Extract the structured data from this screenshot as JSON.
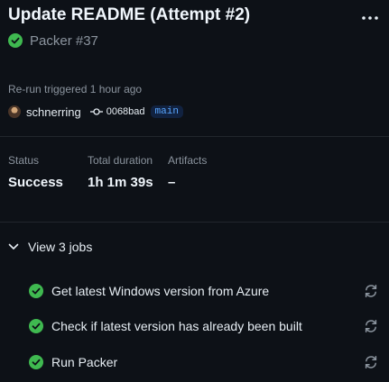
{
  "run": {
    "title": "Update README (Attempt #2)",
    "workflow": "Packer #37",
    "status_color": "#3fb950",
    "trigger_text": "Re-run triggered 1 hour ago",
    "actor": "schnerring",
    "commit_sha": "0068bad",
    "branch": "main"
  },
  "stats": {
    "status_label": "Status",
    "status_value": "Success",
    "duration_label": "Total duration",
    "duration_value": "1h 1m 39s",
    "artifacts_label": "Artifacts",
    "artifacts_value": "–"
  },
  "jobs": {
    "toggle_label": "View 3 jobs",
    "items": [
      {
        "label": "Get latest Windows version from Azure",
        "status": "success",
        "icon": "check-circle-icon",
        "action_icon": "rerun-icon"
      },
      {
        "label": "Check if latest version has already been built",
        "status": "success",
        "icon": "check-circle-icon",
        "action_icon": "rerun-icon"
      },
      {
        "label": "Run Packer",
        "status": "success",
        "icon": "check-circle-icon",
        "action_icon": "rerun-icon"
      }
    ]
  },
  "icons": {
    "menu": "kebab-menu-icon",
    "commit": "git-commit-icon",
    "expand": "chevron-down-icon"
  }
}
